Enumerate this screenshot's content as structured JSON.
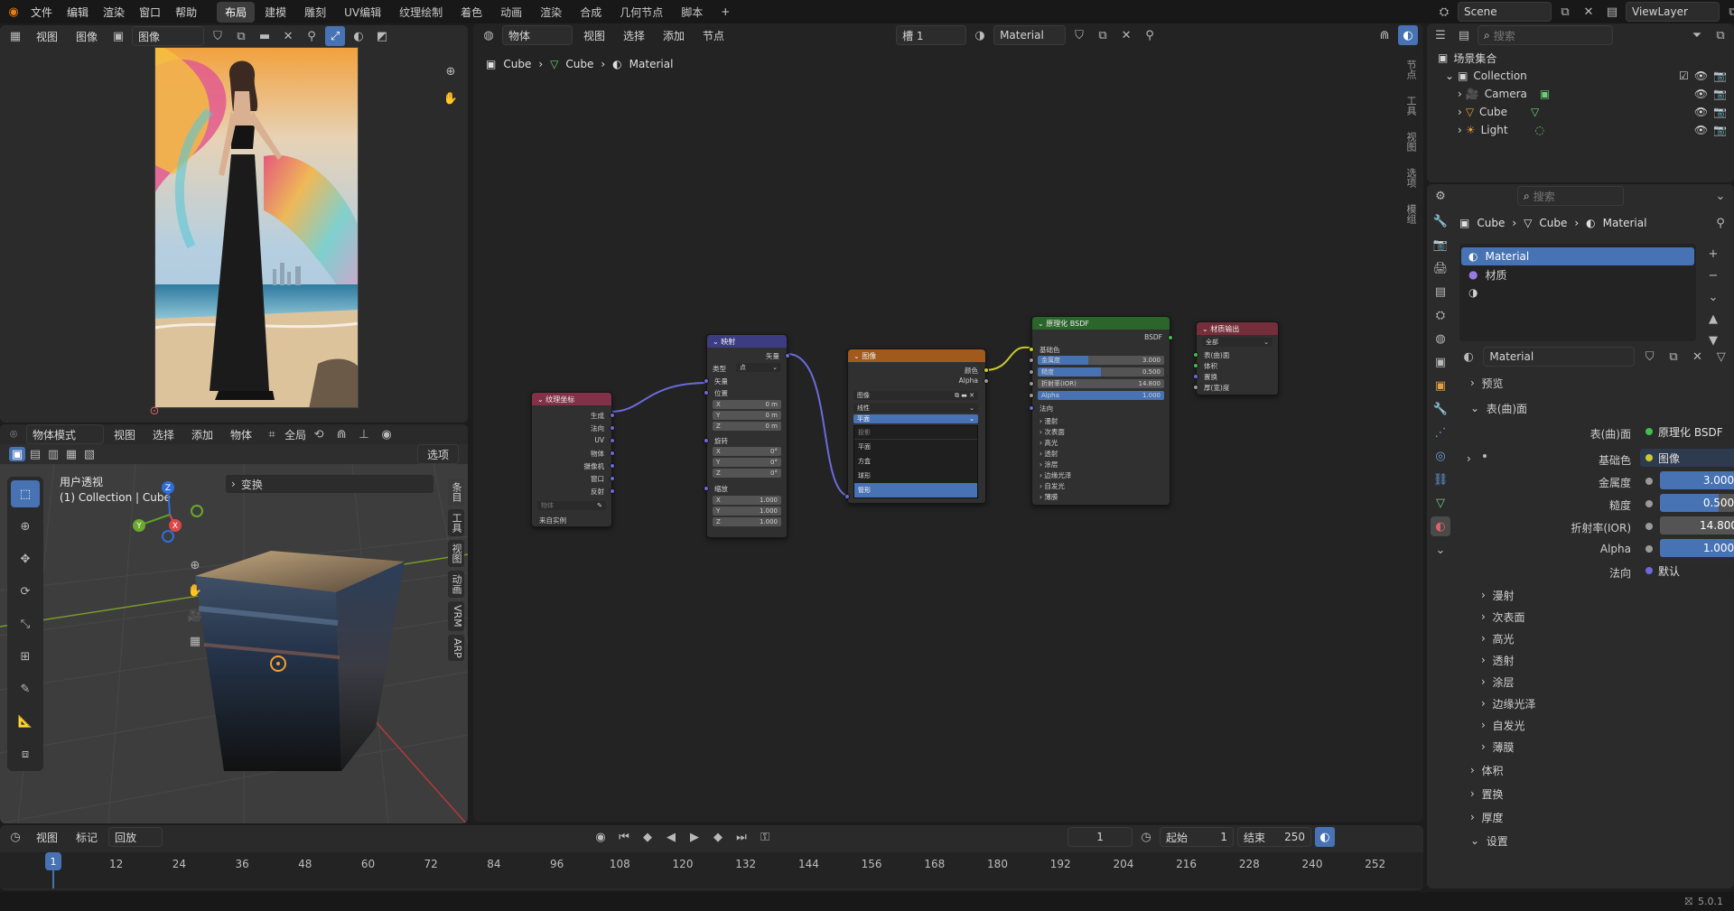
{
  "topbar": {
    "menus": [
      "文件",
      "编辑",
      "渲染",
      "窗口",
      "帮助"
    ],
    "workspaces": [
      "布局",
      "建模",
      "雕刻",
      "UV编辑",
      "纹理绘制",
      "着色",
      "动画",
      "渲染",
      "合成",
      "几何节点",
      "脚本"
    ],
    "active_workspace": "布局",
    "add_tab": "+",
    "scene": "Scene",
    "view_layer": "ViewLayer"
  },
  "image_editor": {
    "menus": [
      "视图",
      "图像"
    ],
    "image_name": "图像"
  },
  "viewport": {
    "mode": "物体模式",
    "menus": [
      "视图",
      "选择",
      "添加",
      "物体"
    ],
    "transform_orientation": "全局",
    "options_label": "选项",
    "view_title": "用户透视",
    "collection_info": "(1) Collection | Cube",
    "transform_panel": "变换",
    "side_tabs": [
      "条目",
      "工具",
      "视图",
      "动画",
      "VRM",
      "ARP"
    ],
    "axis_labels": {
      "x": "X",
      "y": "Y",
      "z": "Z"
    }
  },
  "node_editor": {
    "type": "物体",
    "menus": [
      "视图",
      "选择",
      "添加",
      "节点"
    ],
    "slot": "槽 1",
    "material": "Material",
    "breadcrumb": [
      "Cube",
      "Cube",
      "Material"
    ],
    "side_tabs": [
      "节点",
      "工具",
      "视图",
      "选项",
      "模组"
    ],
    "nodes": {
      "texcoord": {
        "title": "纹理坐标",
        "outputs": [
          "生成",
          "法向",
          "UV",
          "物体",
          "摄像机",
          "窗口",
          "反射"
        ],
        "object_field": "物体",
        "from_instancer": "来自实例"
      },
      "mapping": {
        "title": "映射",
        "output": "矢量",
        "type_label": "类型",
        "type_value": "点",
        "vector_label": "矢量",
        "location_label": "位置",
        "location": [
          "0 m",
          "0 m",
          "0 m"
        ],
        "rotation_label": "旋转",
        "rotation": [
          "0°",
          "0°",
          "0°"
        ],
        "scale_label": "缩放",
        "scale": [
          "1.000",
          "1.000",
          "1.000"
        ],
        "axes": [
          "X",
          "Y",
          "Z"
        ]
      },
      "image": {
        "title": "图像",
        "outputs": [
          "颜色",
          "Alpha"
        ],
        "image_field": "图像",
        "interpolation": "线性",
        "projection_selected": "平面",
        "dropdown_options": [
          "投影",
          "平面",
          "方盒",
          "球形",
          "管形"
        ],
        "highlighted_option": "管形"
      },
      "bsdf": {
        "title": "原理化 BSDF",
        "output": "BSDF",
        "base_color": "基础色",
        "rows": [
          {
            "label": "金属度",
            "value": "3.000"
          },
          {
            "label": "糙度",
            "value": "0.500"
          },
          {
            "label": "折射率(IOR)",
            "value": "14.800"
          },
          {
            "label": "Alpha",
            "value": "1.000"
          }
        ],
        "normal": "法向",
        "subpanels": [
          "漫射",
          "次表面",
          "高光",
          "透射",
          "涂层",
          "边缘光泽",
          "自发光",
          "薄膜"
        ]
      },
      "output": {
        "title": "材质输出",
        "target": "全部",
        "inputs": [
          "表(曲)面",
          "体积",
          "置换",
          "厚(宽)度"
        ]
      }
    }
  },
  "outliner": {
    "search_placeholder": "搜索",
    "root": "场景集合",
    "collection": "Collection",
    "items": [
      "Camera",
      "Cube",
      "Light"
    ]
  },
  "properties": {
    "search_placeholder": "搜索",
    "breadcrumb": [
      "Cube",
      "Cube",
      "Material"
    ],
    "slots": [
      "Material",
      "材质"
    ],
    "material_name": "Material",
    "preview": "预览",
    "surface": "表(曲)面",
    "surface_label": "表(曲)面",
    "surface_value": "原理化 BSDF",
    "base_color_label": "基础色",
    "base_color_value": "图像",
    "fields": [
      {
        "label": "金属度",
        "value": "3.000"
      },
      {
        "label": "糙度",
        "value": "0.500"
      },
      {
        "label": "折射率(IOR)",
        "value": "14.800"
      },
      {
        "label": "Alpha",
        "value": "1.000"
      }
    ],
    "normal_label": "法向",
    "normal_value": "默认",
    "subpanels": [
      "漫射",
      "次表面",
      "高光",
      "透射",
      "涂层",
      "边缘光泽",
      "自发光",
      "薄膜"
    ],
    "sections": [
      "体积",
      "置换",
      "厚度",
      "设置"
    ]
  },
  "timeline": {
    "menus": [
      "视图",
      "标记"
    ],
    "playback": "回放",
    "current_frame": "1",
    "start_label": "起始",
    "start": "1",
    "end_label": "结束",
    "end": "250",
    "ticks": [
      "1",
      "12",
      "24",
      "36",
      "48",
      "60",
      "72",
      "84",
      "96",
      "108",
      "120",
      "132",
      "144",
      "156",
      "168",
      "180",
      "192",
      "204",
      "216",
      "228",
      "240",
      "252"
    ]
  },
  "status": {
    "version": "5.0.1"
  },
  "colors": {
    "accent": "#4772b3",
    "texcoord_header": "#83314a",
    "mapping_header": "#3c3c83",
    "image_header": "#a1591c",
    "bsdf_header": "#2b652b",
    "output_header": "#752f3a"
  }
}
